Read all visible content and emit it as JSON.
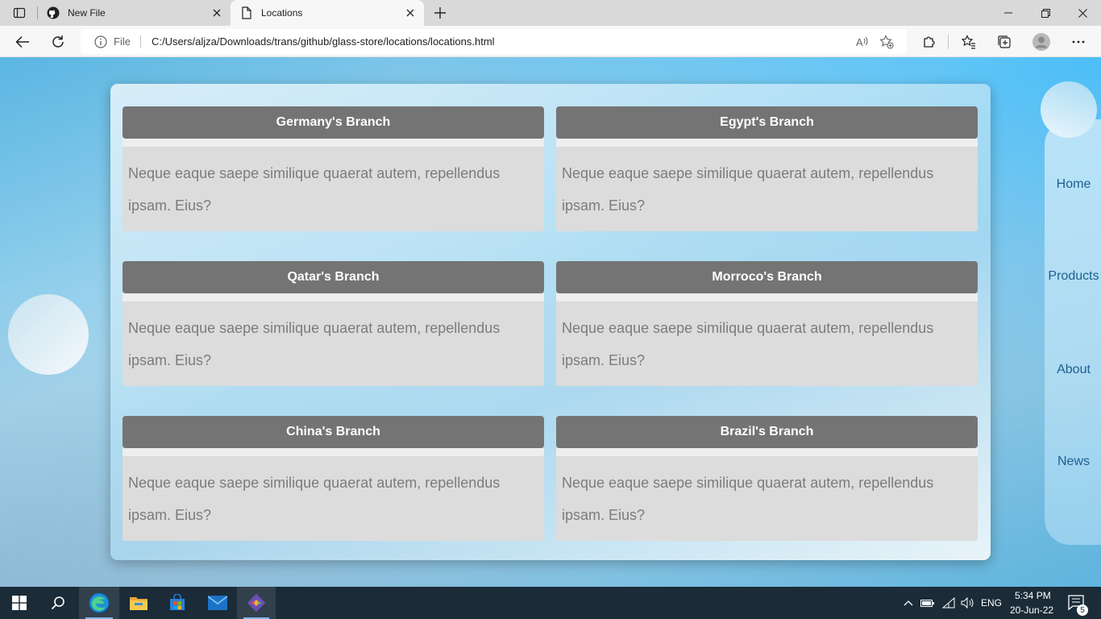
{
  "browser": {
    "tabs": [
      {
        "title": "New File",
        "icon": "github-icon"
      },
      {
        "title": "Locations",
        "icon": "page-icon"
      }
    ],
    "address": {
      "scheme_label": "File",
      "url": "C:/Users/aljza/Downloads/trans/github/glass-store/locations/locations.html"
    }
  },
  "page": {
    "branches": [
      {
        "name": "Germany's Branch",
        "text": "Neque eaque saepe similique quaerat autem, repellendus ipsam. Eius?"
      },
      {
        "name": "Egypt's Branch",
        "text": "Neque eaque saepe similique quaerat autem, repellendus ipsam. Eius?"
      },
      {
        "name": "Qatar's Branch",
        "text": "Neque eaque saepe similique quaerat autem, repellendus ipsam. Eius?"
      },
      {
        "name": "Morroco's Branch",
        "text": "Neque eaque saepe similique quaerat autem, repellendus ipsam. Eius?"
      },
      {
        "name": "China's Branch",
        "text": "Neque eaque saepe similique quaerat autem, repellendus ipsam. Eius?"
      },
      {
        "name": "Brazil's Branch",
        "text": "Neque eaque saepe similique quaerat autem, repellendus ipsam. Eius?"
      }
    ],
    "nav": [
      {
        "label": "Home"
      },
      {
        "label": "Products"
      },
      {
        "label": "About"
      },
      {
        "label": "News"
      }
    ],
    "colors": {
      "card_header": "#747474",
      "card_body": "#dcdcdc",
      "nav_text": "#1d5f8e"
    }
  },
  "taskbar": {
    "apps": [
      "windows-start-icon",
      "search-icon",
      "edge-icon",
      "file-explorer-icon",
      "microsoft-store-icon",
      "mail-icon",
      "git-icon"
    ],
    "language": "ENG",
    "time": "5:34 PM",
    "date": "20-Jun-22",
    "notification_count": "5"
  }
}
